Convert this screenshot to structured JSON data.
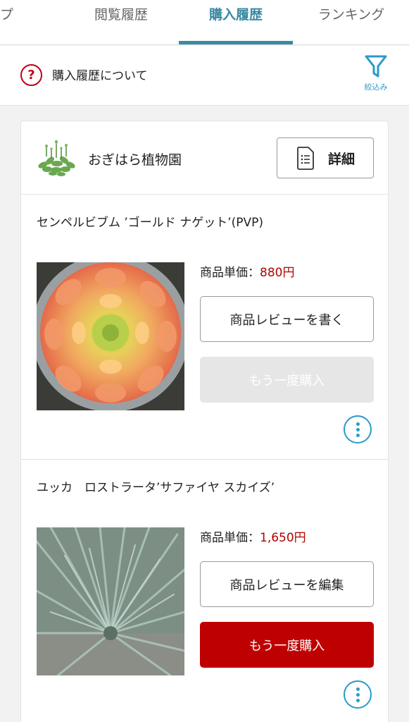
{
  "tabs": [
    {
      "label": "ップ"
    },
    {
      "label": "閲覧履歴"
    },
    {
      "label": "購入履歴"
    },
    {
      "label": "ランキング"
    }
  ],
  "about": {
    "label": "購入履歴について",
    "filter_label": "絞込み"
  },
  "order": {
    "shop_name": "おぎはら植物園",
    "detail_label": "詳細",
    "items": [
      {
        "title": "センペルビブム ’ゴールド ナゲット’(PVP)",
        "price_label": "商品単価：",
        "price": "880円",
        "review_button": "商品レビューを書く",
        "rebuy_button": "もう一度購入"
      },
      {
        "title": "ユッカ　ロストラータ’サファイヤ スカイズ’",
        "price_label": "商品単価：",
        "price": "1,650円",
        "review_button": "商品レビューを編集",
        "rebuy_button": "もう一度購入"
      }
    ]
  },
  "colors": {
    "accent_tab": "#3a8aa3",
    "price": "#b30000",
    "primary": "#bf0000",
    "icon_blue": "#2a9ac8"
  }
}
